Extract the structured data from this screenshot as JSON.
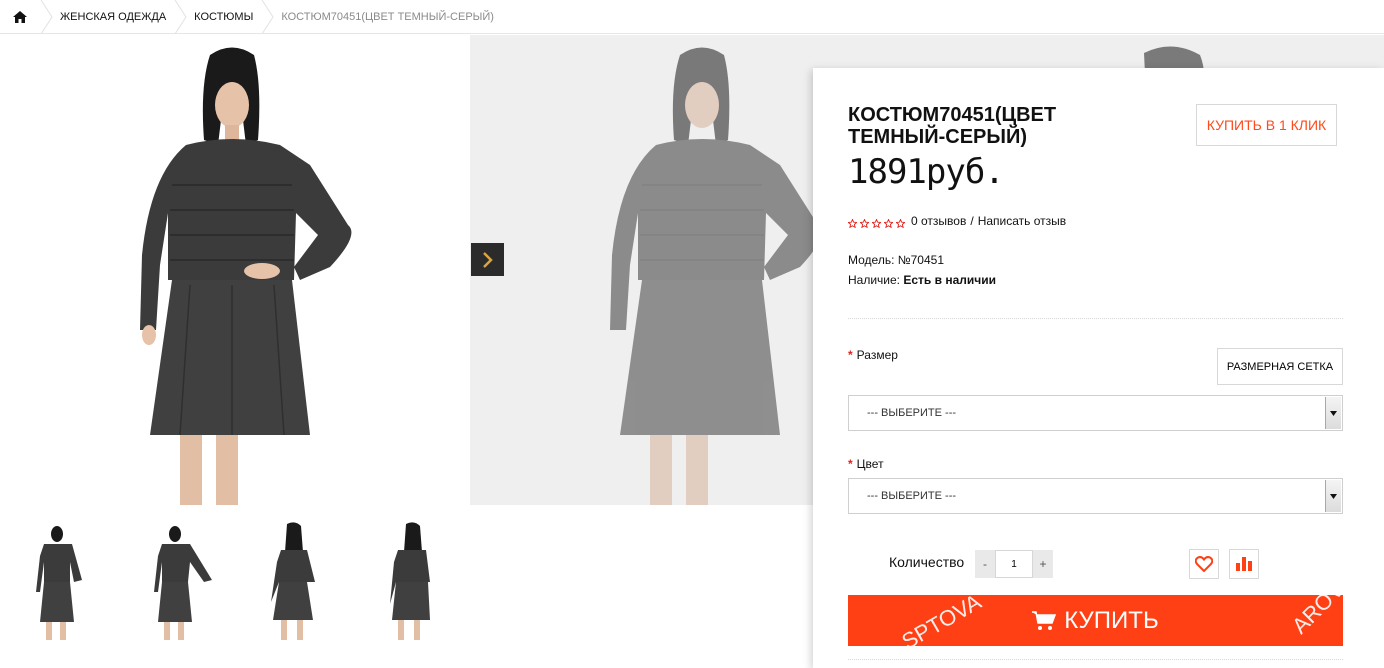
{
  "breadcrumb": {
    "home_icon": "home-icon",
    "items": [
      "ЖЕНСКАЯ ОДЕЖДА",
      "КОСТЮМЫ"
    ],
    "current": "КОСТЮМ70451(ЦВЕТ ТЕМНЫЙ-СЕРЫЙ)"
  },
  "gallery": {
    "next_icon": "chevron-right-icon",
    "thumbnails": [
      "front",
      "front-turned",
      "back-left",
      "back-right"
    ]
  },
  "product": {
    "title": "КОСТЮМ70451(ЦВЕТ ТЕМНЫЙ-СЕРЫЙ)",
    "price": "1891руб.",
    "one_click_label": "КУПИТЬ В 1 КЛИК",
    "rating": {
      "stars": 0,
      "max": 5,
      "reviews_text": "0 отзывов",
      "separator": "/",
      "write_review": "Написать отзыв"
    },
    "model_label": "Модель:",
    "model_value": "№70451",
    "availability_label": "Наличие:",
    "availability_value": "Есть в наличии"
  },
  "options": {
    "size": {
      "label": "Размер",
      "required_mark": "*",
      "size_chart_label": "РАЗМЕРНАЯ СЕТКА",
      "selected": "--- ВЫБЕРИТЕ ---"
    },
    "color": {
      "label": "Цвет",
      "required_mark": "*",
      "selected": "--- ВЫБЕРИТЕ ---"
    }
  },
  "cart": {
    "quantity_label": "Количество",
    "quantity_value": "1",
    "minus": "-",
    "plus": "+",
    "wishlist_icon": "heart-icon",
    "compare_icon": "bar-chart-icon",
    "buy_label": "КУПИТЬ",
    "buy_icon": "cart-icon",
    "watermark_left": "sptova",
    "watermark_right": "arov"
  },
  "colors": {
    "accent": "#ff4015",
    "accent_text": "#ff4a1a",
    "star": "#e0231d",
    "garment": "#3a3b3a"
  }
}
